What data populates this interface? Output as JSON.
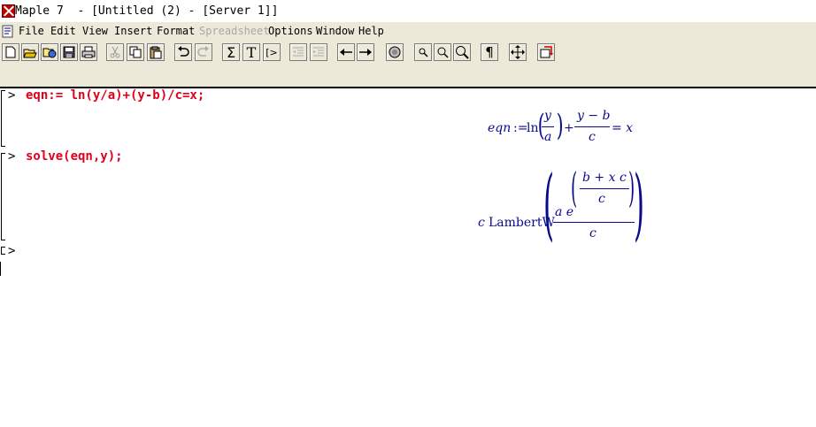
{
  "window": {
    "title": "Maple 7  - [Untitled (2) - [Server 1]]"
  },
  "menu": {
    "items": [
      {
        "label": "File",
        "enabled": true
      },
      {
        "label": "Edit",
        "enabled": true
      },
      {
        "label": "View",
        "enabled": true
      },
      {
        "label": "Insert",
        "enabled": true
      },
      {
        "label": "Format",
        "enabled": true
      },
      {
        "label": "Spreadsheet",
        "enabled": false
      },
      {
        "label": "Options",
        "enabled": true
      },
      {
        "label": "Window",
        "enabled": true
      },
      {
        "label": "Help",
        "enabled": true
      }
    ]
  },
  "toolbar": {
    "buttons": [
      {
        "name": "new",
        "icon": "new-document-icon",
        "enabled": true
      },
      {
        "name": "open",
        "icon": "open-folder-icon",
        "enabled": true
      },
      {
        "name": "open-url",
        "icon": "open-url-icon",
        "enabled": true
      },
      {
        "name": "save",
        "icon": "save-disk-icon",
        "enabled": true
      },
      {
        "name": "print",
        "icon": "printer-icon",
        "enabled": true
      },
      {
        "name": "cut",
        "icon": "scissors-icon",
        "enabled": false
      },
      {
        "name": "copy",
        "icon": "copy-icon",
        "enabled": true
      },
      {
        "name": "paste",
        "icon": "paste-icon",
        "enabled": true
      },
      {
        "name": "undo",
        "icon": "undo-icon",
        "enabled": true
      },
      {
        "name": "redo",
        "icon": "redo-icon",
        "enabled": false
      },
      {
        "name": "math",
        "icon": "sigma-icon",
        "label": "Σ",
        "enabled": true
      },
      {
        "name": "text",
        "icon": "text-t-icon",
        "label": "T",
        "enabled": true
      },
      {
        "name": "input",
        "icon": "prompt-icon",
        "label": "[>",
        "enabled": true
      },
      {
        "name": "outdent",
        "icon": "outdent-icon",
        "enabled": false
      },
      {
        "name": "indent",
        "icon": "indent-icon",
        "enabled": false
      },
      {
        "name": "back",
        "icon": "arrow-left-icon",
        "enabled": true
      },
      {
        "name": "forward",
        "icon": "arrow-right-icon",
        "enabled": true
      },
      {
        "name": "stop",
        "icon": "stop-icon",
        "enabled": true
      },
      {
        "name": "zoom-100",
        "icon": "zoom-small-icon",
        "enabled": true
      },
      {
        "name": "zoom-150",
        "icon": "zoom-medium-icon",
        "enabled": true
      },
      {
        "name": "zoom-200",
        "icon": "zoom-large-icon",
        "enabled": true
      },
      {
        "name": "show-nonprinting",
        "icon": "pilcrow-icon",
        "label": "¶",
        "enabled": true
      },
      {
        "name": "expand",
        "icon": "expand-arrows-icon",
        "enabled": true
      },
      {
        "name": "restart",
        "icon": "restart-icon",
        "enabled": true
      }
    ]
  },
  "worksheet": {
    "prompt_symbol": ">",
    "commands": [
      {
        "input": "eqn:= ln(y/a)+(y-b)/c=x;",
        "output": {
          "lhs": "eqn",
          "assign": ":=",
          "func": "ln",
          "frac1_num": "y",
          "frac1_den": "a",
          "plus": "+",
          "frac2_num": "y − b",
          "frac2_den": "c",
          "equals": "= x"
        }
      },
      {
        "input": "solve(eqn,y);",
        "output": {
          "coef": "c",
          "func": "LambertW",
          "num_base": "a e",
          "exp_num": "b + x c",
          "exp_den": "c",
          "den": "c"
        }
      }
    ]
  },
  "colors": {
    "input_text": "#e0001b",
    "output_text": "#0a0a8c",
    "chrome_bg": "#ece9d8"
  }
}
